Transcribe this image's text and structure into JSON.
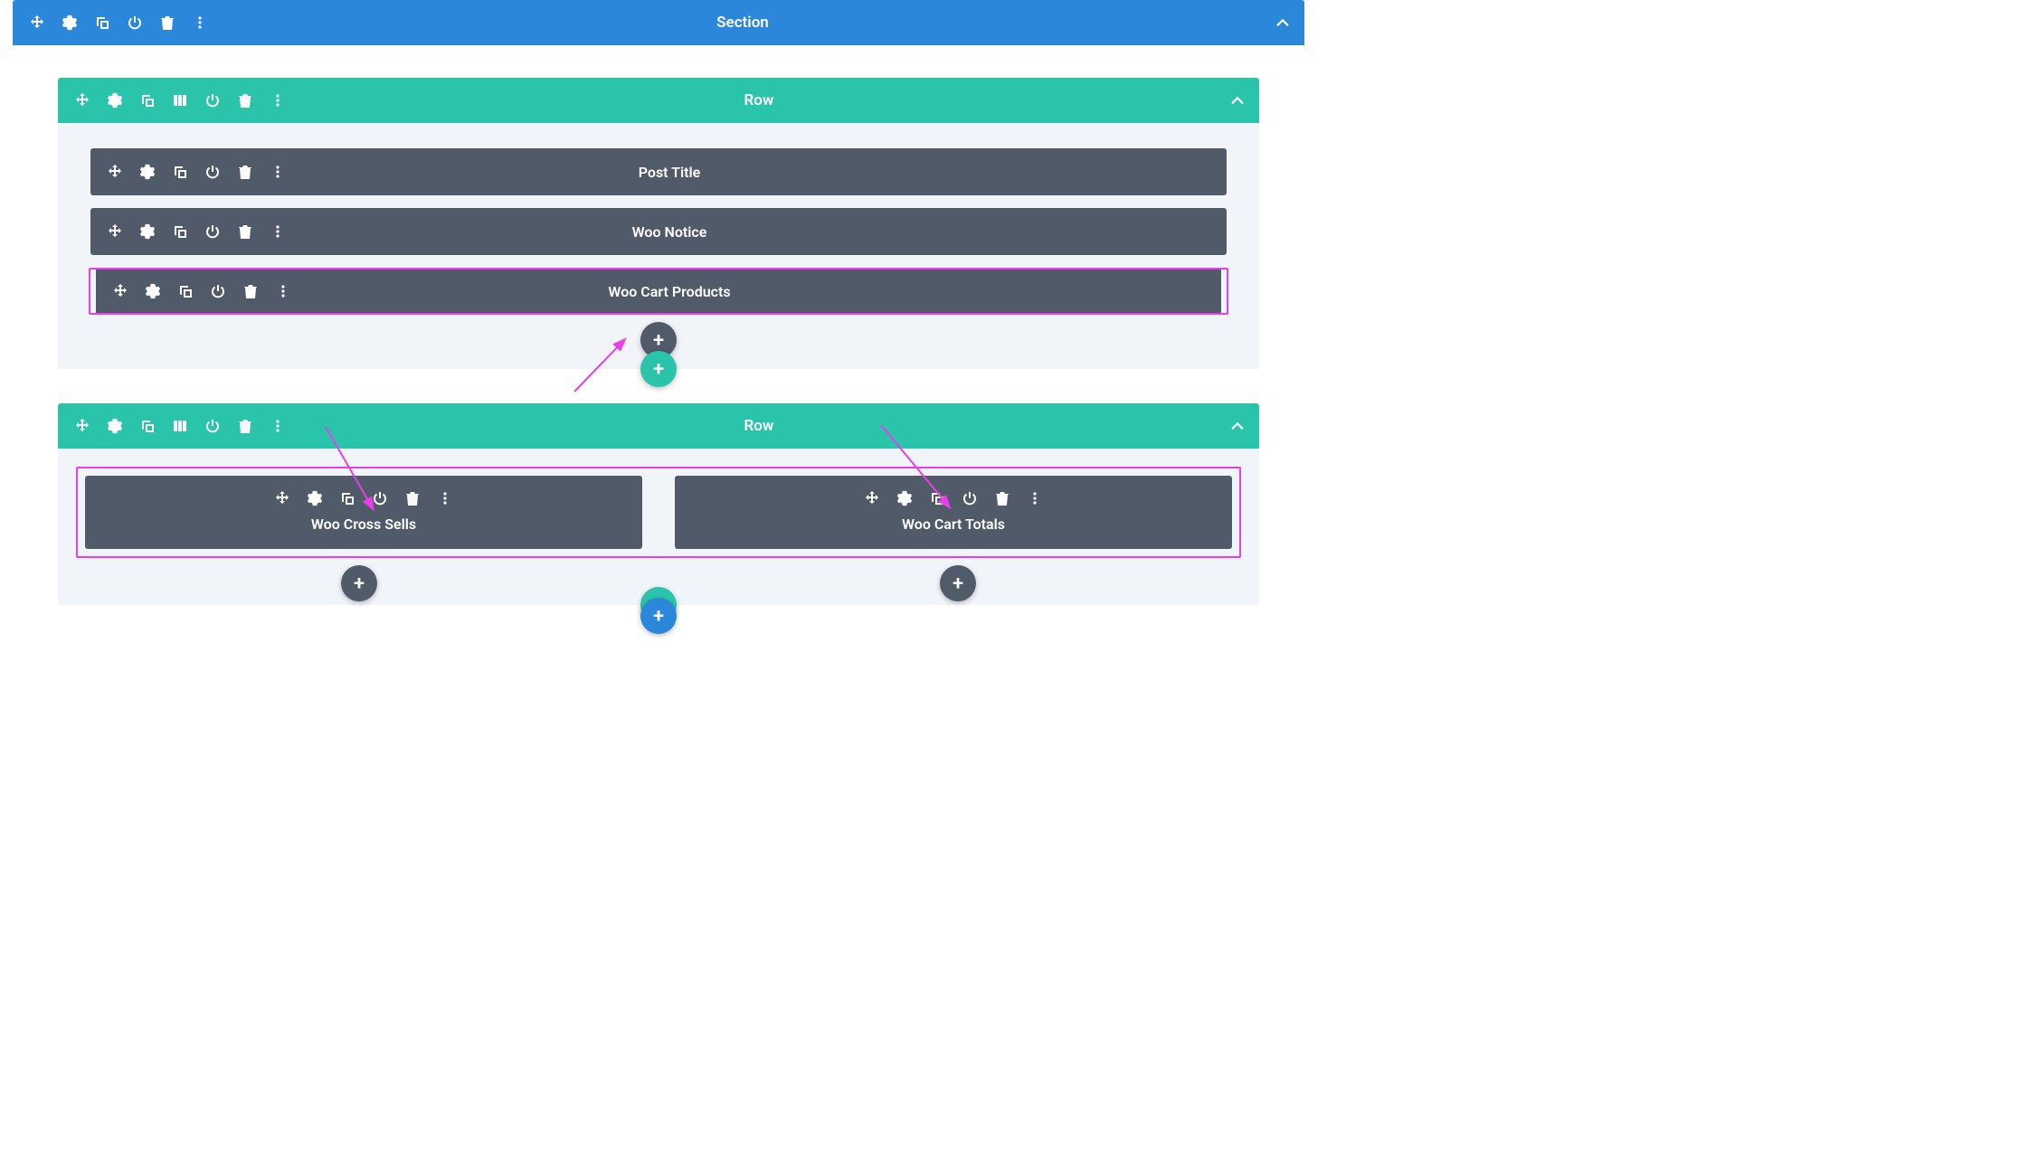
{
  "section": {
    "title": "Section"
  },
  "rows": [
    {
      "title": "Row",
      "modules": [
        {
          "title": "Post Title"
        },
        {
          "title": "Woo Notice"
        },
        {
          "title": "Woo Cart Products"
        }
      ]
    },
    {
      "title": "Row",
      "columns": [
        {
          "title": "Woo Cross Sells"
        },
        {
          "title": "Woo Cart Totals"
        }
      ]
    }
  ],
  "colors": {
    "section_header": "#2b87da",
    "row_header": "#29c4a9",
    "module_bg": "#515a69",
    "row_body": "#f1f5f9",
    "highlight": "#e83fe8"
  }
}
